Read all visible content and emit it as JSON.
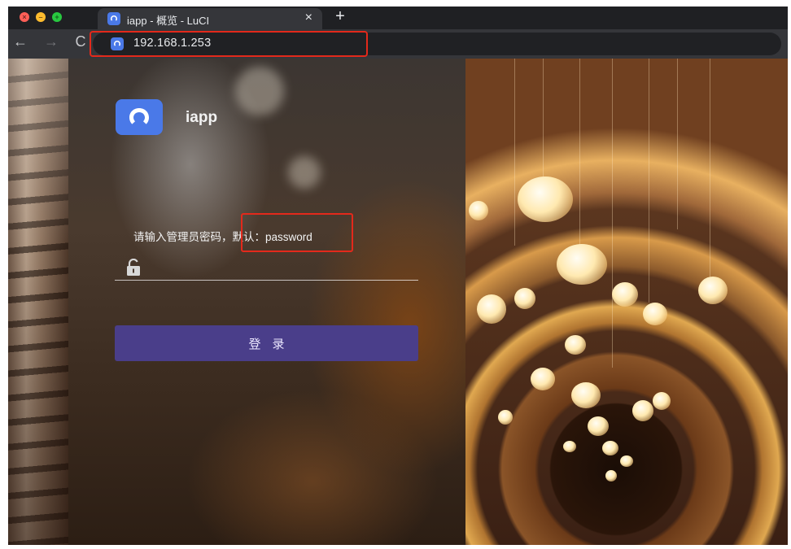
{
  "browser": {
    "tab_title": "iapp - 概览 - LuCI",
    "tab_close": "×",
    "new_tab": "+",
    "url": "192.168.1.253",
    "nav": {
      "back": "←",
      "forward": "→",
      "reload": "C"
    }
  },
  "login": {
    "brand": "iapp",
    "prompt": "请输入管理员密码，默认：password",
    "password_value": "",
    "button_label": "登录"
  },
  "colors": {
    "accent_logo": "#4a79e8",
    "login_button": "#4a3e8a",
    "highlight_box": "#e3291b"
  },
  "icons": [
    "close-traffic-icon",
    "minimize-traffic-icon",
    "maximize-traffic-icon",
    "site-favicon",
    "back-arrow-icon",
    "forward-arrow-icon",
    "reload-icon",
    "lock-icon",
    "app-logo-icon"
  ]
}
